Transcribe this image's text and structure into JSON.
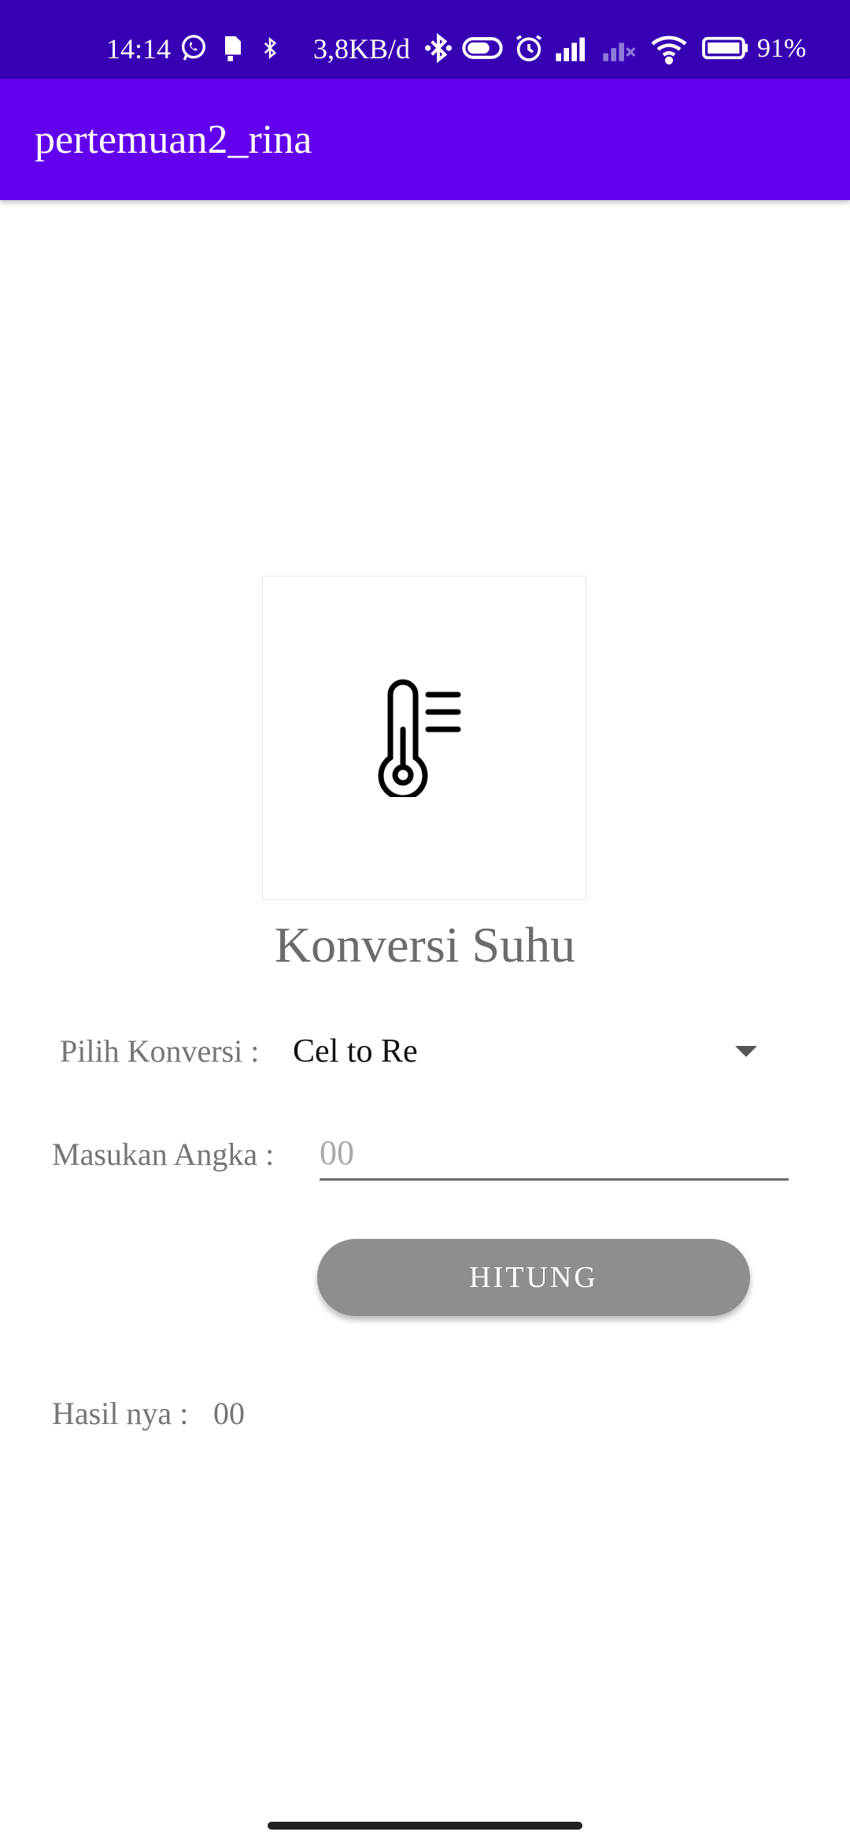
{
  "status_bar": {
    "time": "14:14",
    "network_speed": "3,8KB/d",
    "battery": "91%",
    "icons": [
      "whatsapp-icon",
      "sim-card-icon",
      "bluetooth-small-icon",
      "bluetooth-icon",
      "toggle-icon",
      "alarm-icon",
      "signal-icon",
      "signal-off-icon",
      "wifi-icon",
      "battery-icon"
    ],
    "background": "#3700b3"
  },
  "app_bar": {
    "title": "pertemuan2_rina",
    "background": "#6200ee"
  },
  "main": {
    "image_icon": "thermometer-icon",
    "heading": "Konversi Suhu",
    "konversi_label": "Pilih Konversi :",
    "konversi_value": "Cel to Re",
    "angka_label": "Masukan Angka :",
    "angka_placeholder": "00",
    "button_label": "HITUNG",
    "hasil_label": "Hasil nya :",
    "hasil_value": "00"
  }
}
